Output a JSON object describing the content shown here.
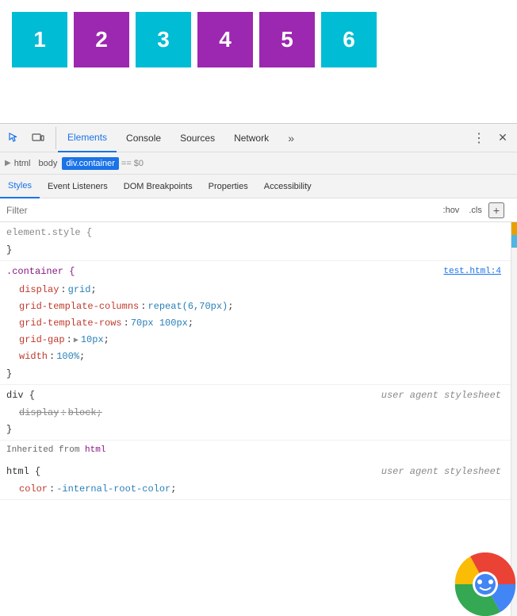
{
  "preview": {
    "boxes": [
      {
        "id": 1,
        "label": "1",
        "color": "#00bcd4"
      },
      {
        "id": 2,
        "label": "2",
        "color": "#9c27b0"
      },
      {
        "id": 3,
        "label": "3",
        "color": "#00bcd4"
      },
      {
        "id": 4,
        "label": "4",
        "color": "#9c27b0"
      },
      {
        "id": 5,
        "label": "5",
        "color": "#9c27b0"
      },
      {
        "id": 6,
        "label": "6",
        "color": "#00bcd4"
      }
    ]
  },
  "devtools": {
    "toolbar": {
      "inspect_icon": "⬜",
      "device_icon": "📱",
      "tabs": [
        {
          "id": "elements",
          "label": "Elements",
          "active": true
        },
        {
          "id": "console",
          "label": "Console",
          "active": false
        },
        {
          "id": "sources",
          "label": "Sources",
          "active": false
        },
        {
          "id": "network",
          "label": "Network",
          "active": false
        }
      ],
      "more_label": "»",
      "menu_label": "⋮",
      "close_label": "✕"
    },
    "breadcrumb": {
      "items": [
        "html",
        "body",
        "div.container"
      ],
      "current": "div.container",
      "equals": "==",
      "dollar": "$0"
    },
    "styles_tabs": [
      {
        "id": "styles",
        "label": "Styles",
        "active": true
      },
      {
        "id": "event-listeners",
        "label": "Event Listeners",
        "active": false
      },
      {
        "id": "dom-breakpoints",
        "label": "DOM Breakpoints",
        "active": false
      },
      {
        "id": "properties",
        "label": "Properties",
        "active": false
      },
      {
        "id": "accessibility",
        "label": "Accessibility",
        "active": false
      }
    ],
    "filter": {
      "placeholder": "Filter",
      "hov_label": ":hov",
      "cls_label": ".cls",
      "plus_label": "+"
    },
    "css_rules": [
      {
        "id": "element-style",
        "selector": "element.style",
        "brace_open": "{",
        "brace_close": "}",
        "source": null,
        "properties": []
      },
      {
        "id": "container",
        "selector": ".container",
        "brace_open": "{",
        "brace_close": "}",
        "source": "test.html:4",
        "properties": [
          {
            "name": "display",
            "colon": ":",
            "value": "grid",
            "unit": "",
            "strikethrough": false
          },
          {
            "name": "grid-template-columns",
            "colon": ":",
            "value": "repeat(6,70px)",
            "unit": "",
            "strikethrough": false
          },
          {
            "name": "grid-template-rows",
            "colon": ":",
            "value": "70px 100px",
            "unit": "",
            "strikethrough": false
          },
          {
            "name": "grid-gap",
            "colon": ":",
            "value": "▶ 10px",
            "unit": "",
            "strikethrough": false
          },
          {
            "name": "width",
            "colon": ":",
            "value": "100%",
            "unit": "",
            "strikethrough": false
          }
        ]
      },
      {
        "id": "div-user-agent",
        "selector": "div",
        "brace_open": "{",
        "brace_close": "}",
        "source": "user agent stylesheet",
        "properties": [
          {
            "name": "display",
            "colon": ":",
            "value": "block",
            "unit": "",
            "strikethrough": true
          }
        ]
      },
      {
        "id": "inherited",
        "label": "Inherited from",
        "tag": "html"
      },
      {
        "id": "html-user-agent",
        "selector": "html",
        "brace_open": "{",
        "brace_close": "}",
        "source": "user agent stylesheet",
        "properties": [
          {
            "name": "color",
            "colon": ":",
            "value": "-internal-root-color",
            "unit": "",
            "strikethrough": false
          }
        ]
      }
    ]
  }
}
